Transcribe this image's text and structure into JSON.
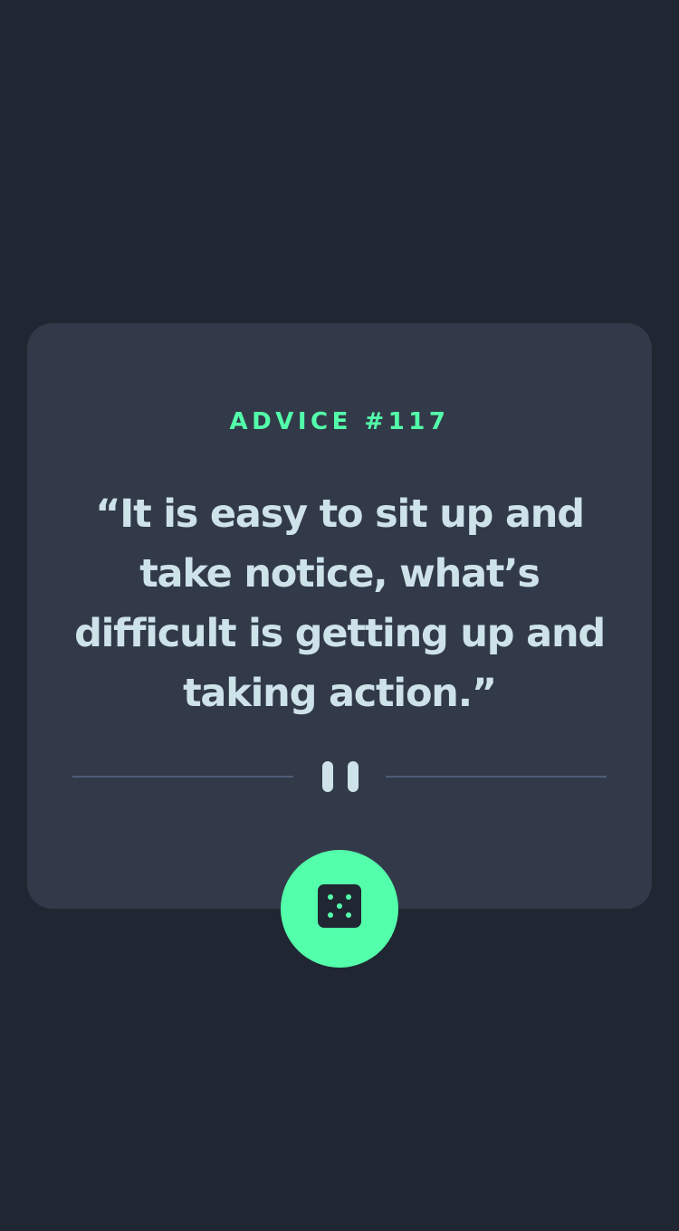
{
  "advice": {
    "id_label": "ADVICE #117",
    "quote": "“It is easy to sit up and take notice, what’s difficult is getting up and taking action.”"
  },
  "divider": {
    "icon": "pause-icon"
  },
  "dice_button": {
    "icon": "dice-icon"
  },
  "colors": {
    "background": "#202632",
    "card": "#323a49",
    "accent": "#53ffaa",
    "text": "#cee3e9",
    "divider": "#4f5d74"
  }
}
